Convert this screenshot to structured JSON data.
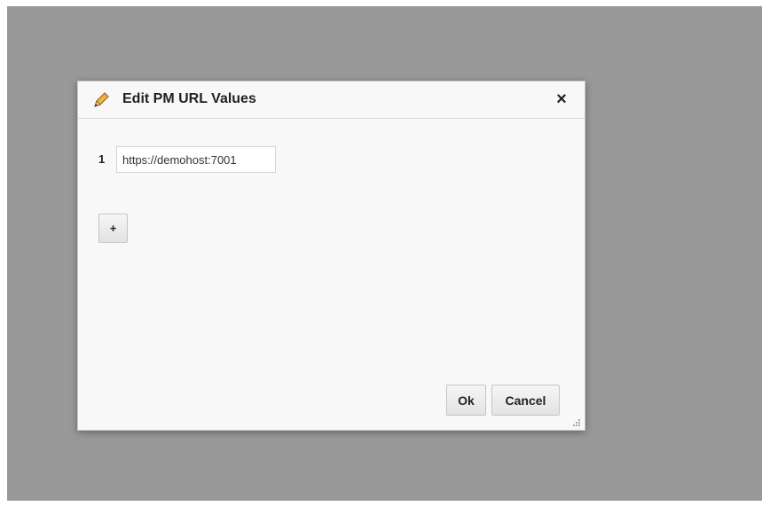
{
  "dialog": {
    "title": "Edit PM URL Values",
    "close_label": "×",
    "rows": [
      {
        "index": "1",
        "value": "https://demohost:7001"
      }
    ],
    "add_label": "+",
    "ok_label": "Ok",
    "cancel_label": "Cancel"
  },
  "icons": {
    "edit": "pencil-icon",
    "close": "close-icon",
    "resize": "resize-grip-icon"
  },
  "colors": {
    "overlay": "#999999",
    "dialog_bg": "#f8f8f8",
    "pencil": "#e0a030"
  }
}
